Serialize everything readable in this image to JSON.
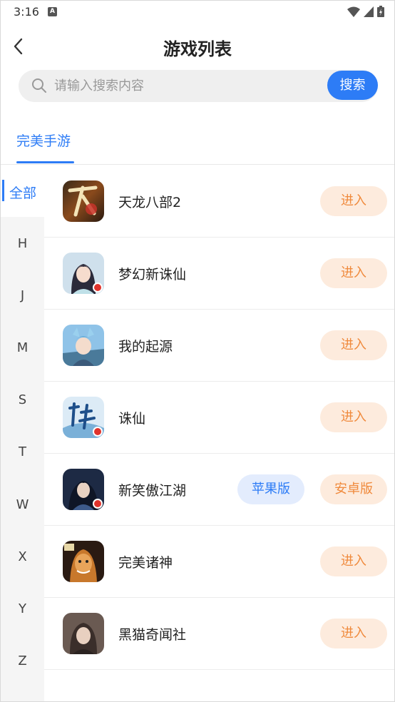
{
  "status": {
    "time": "3:16",
    "a_icon": "A"
  },
  "header": {
    "title": "游戏列表"
  },
  "search": {
    "placeholder": "请输入搜索内容",
    "button_label": "搜索"
  },
  "tabs": [
    {
      "label": "完美手游",
      "active": true
    }
  ],
  "index": {
    "all_label": "全部",
    "letters": [
      "H",
      "J",
      "M",
      "S",
      "T",
      "W",
      "X",
      "Y",
      "Z"
    ]
  },
  "games": [
    {
      "name": "天龙八部2",
      "icon": "tianlong-icon",
      "action": "进入"
    },
    {
      "name": "梦幻新诛仙",
      "icon": "menghuan-icon",
      "action": "进入"
    },
    {
      "name": "我的起源",
      "icon": "qiyuan-icon",
      "action": "进入"
    },
    {
      "name": "诛仙",
      "icon": "zhuxian-icon",
      "action": "进入"
    },
    {
      "name": "新笑傲江湖",
      "icon": "xiaoao-icon",
      "apple_label": "苹果版",
      "android_label": "安卓版"
    },
    {
      "name": "完美诸神",
      "icon": "zhushen-icon",
      "action": "进入"
    },
    {
      "name": "黑猫奇闻社",
      "icon": "heimao-icon",
      "action": "进入"
    }
  ],
  "colors": {
    "accent": "#2d7cf6",
    "enter_bg": "#fdebdd",
    "enter_text": "#f08a3c",
    "apple_bg": "#e3ecfd"
  }
}
